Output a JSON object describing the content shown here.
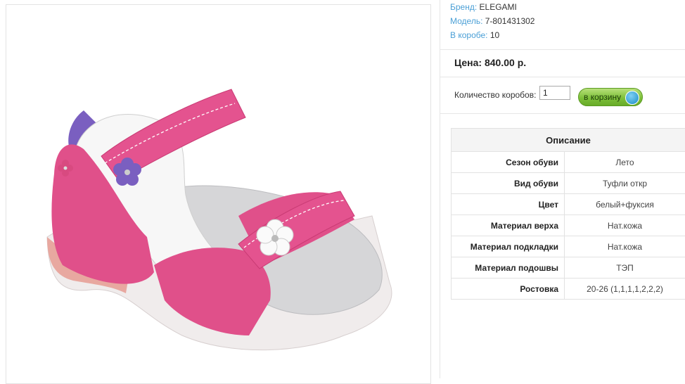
{
  "product": {
    "brand_label": "Бренд:",
    "brand": "ELEGAMI",
    "model_label": "Модель:",
    "model": "7-801431302",
    "box_label": "В коробе:",
    "box_qty": "10",
    "price": "Цена: 840.00 р.",
    "image_icon": "sandal-product-photo"
  },
  "order": {
    "qty_label": "Количество коробов:",
    "qty_value": "1",
    "cart_button": "в корзину",
    "cart_icon": "cart-icon"
  },
  "description": {
    "title": "Описание",
    "rows": [
      {
        "key": "Сезон обуви",
        "value": "Лето"
      },
      {
        "key": "Вид обуви",
        "value": "Туфли откр"
      },
      {
        "key": "Цвет",
        "value": "белый+фуксия"
      },
      {
        "key": "Материал верха",
        "value": "Нат.кожа"
      },
      {
        "key": "Материал подкладки",
        "value": "Нат.кожа"
      },
      {
        "key": "Материал подошвы",
        "value": "ТЭП"
      },
      {
        "key": "Ростовка",
        "value": "20-26 (1,1,1,1,2,2,2)"
      }
    ]
  },
  "colors": {
    "link_blue": "#4a9fd6",
    "button_green": "#7ec13a",
    "fuchsia": "#e0508a",
    "violet": "#7a5fc0"
  }
}
